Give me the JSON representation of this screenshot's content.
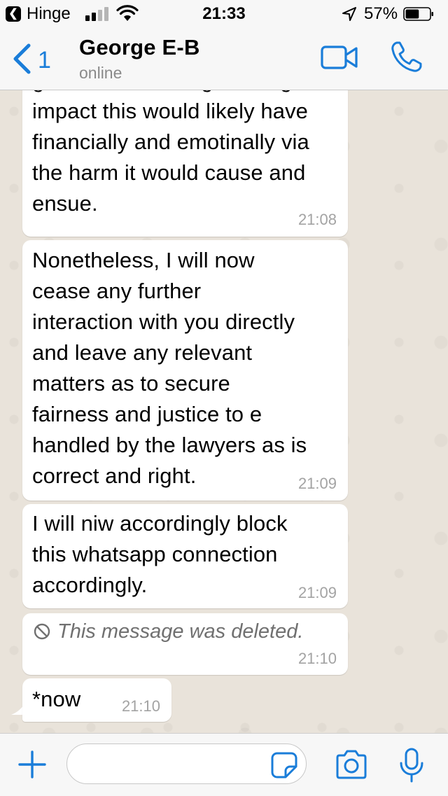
{
  "status_bar": {
    "back_app": "Hinge",
    "time": "21:33",
    "battery_percent": "57%",
    "signal_bars_filled": 2,
    "battery_level": 0.57,
    "icons": [
      "back-arrow-icon",
      "signal-icon",
      "wifi-icon",
      "location-arrow-icon",
      "battery-icon"
    ]
  },
  "header": {
    "back_count": "1",
    "contact_name": "George E-B",
    "contact_status": "online",
    "icons": [
      "chevron-left-icon",
      "video-camera-icon",
      "phone-icon"
    ],
    "accent_color": "#1a7dd9"
  },
  "messages": [
    {
      "text": "given and knowing the huge\nimpact this would likely have\nfinancially and emotinally via\nthe harm it would cause and\nensue.",
      "time": "21:08"
    },
    {
      "text": "Nonetheless, I will now\ncease any further\ninteraction with you directly\nand leave any relevant\nmatters as to secure\nfairness and justice to e\nhandled by the lawyers as is\ncorrect and right.",
      "time": "21:09"
    },
    {
      "text": "I will niw accordingly block\nthis whatsapp connection\naccordingly.",
      "time": "21:09"
    },
    {
      "text": "This message was deleted.",
      "time": "21:10",
      "deleted": true,
      "icon": "prohibited-icon"
    },
    {
      "text": "*now",
      "time": "21:10"
    }
  ],
  "input_bar": {
    "value": "",
    "placeholder": "",
    "icons": [
      "plus-icon",
      "sticker-icon",
      "camera-icon",
      "microphone-icon"
    ]
  }
}
